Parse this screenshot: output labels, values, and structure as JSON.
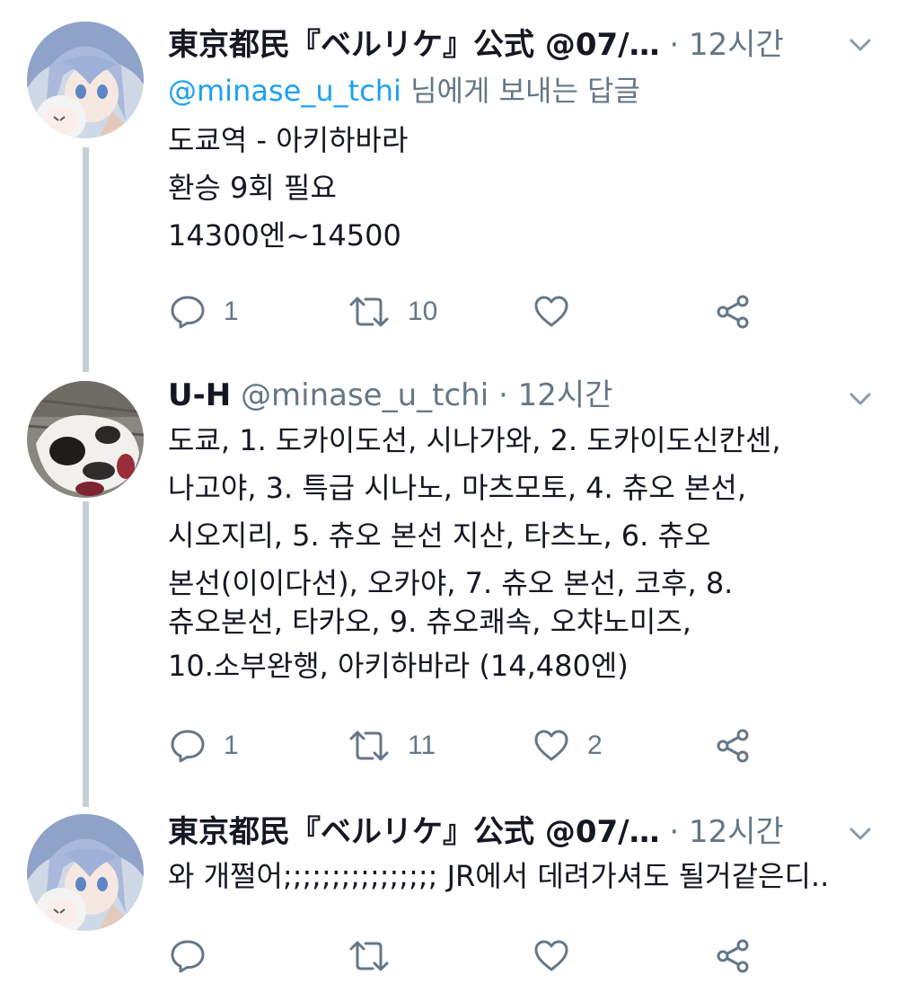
{
  "tweets": [
    {
      "name": "東京都民『ベルリケ』公式 @07/…",
      "handle": "",
      "separator": "·",
      "time": "12시간",
      "reply_to_mention": "@minase_u_tchi",
      "reply_to_suffix": " 님에게 보내는 답글",
      "body_lines": [
        "도쿄역 - 아키하바라",
        "환승 9회 필요",
        "14300엔~14500"
      ],
      "actions": {
        "reply_count": "1",
        "retweet_count": "10",
        "like_count": ""
      },
      "avatar_icon": "anime-girl-avatar-icon"
    },
    {
      "name": "U-H",
      "handle": "@minase_u_tchi",
      "separator": "·",
      "time": "12시간",
      "body_lines": [
        "도쿄, 1. 도카이도선, 시나가와, 2. 도카이도신칸센,",
        "나고야, 3. 특급 시나노, 마츠모토, 4. 츄오 본선,",
        "시오지리, 5. 츄오 본선 지산, 타츠노, 6. 츄오",
        "본선(이이다선), 오카야, 7. 츄오 본선, 코후, 8.",
        "츄오본선, 타카오, 9. 츄오쾌속, 오챠노미즈,",
        "10.소부완행, 아키하바라 (14,480엔)"
      ],
      "actions": {
        "reply_count": "1",
        "retweet_count": "11",
        "like_count": "2"
      },
      "avatar_icon": "dog-photo-avatar-icon"
    },
    {
      "name": "東京都民『ベルリケ』公式 @07/…",
      "handle": "",
      "separator": "·",
      "time": "12시간",
      "body_lines": [
        "와 개쩔어;;;;;;;;;;;;;;;; JR에서 데려가셔도 될거같은디.."
      ],
      "actions": {
        "reply_count": "",
        "retweet_count": "",
        "like_count": ""
      },
      "avatar_icon": "anime-girl-avatar-icon"
    }
  ],
  "colors": {
    "text": "#141823",
    "secondary": "#657786",
    "mention": "#1da1f2",
    "thread_line": "#c4cfd6"
  },
  "icons": {
    "reply": "reply-bubble-icon",
    "retweet": "retweet-icon",
    "like": "heart-icon",
    "share": "share-icon",
    "menu": "chevron-down-icon"
  }
}
